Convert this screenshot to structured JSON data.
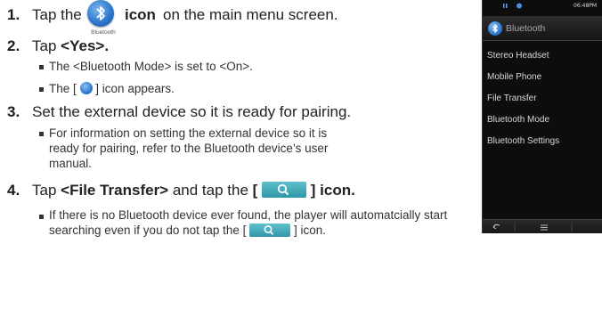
{
  "step1": {
    "number": "1.",
    "text_before": "Tap the",
    "icon_caption": "Bluetooth",
    "icon_bold": "icon",
    "text_after": "on the main menu screen."
  },
  "step2": {
    "number": "2.",
    "text": "Tap",
    "bold": "<Yes>.",
    "bullets": [
      "The <Bluetooth Mode> is set to <On>.",
      {
        "before": "The [",
        "after": "] icon appears."
      }
    ]
  },
  "step3": {
    "number": "3.",
    "text": "Set the external device so it is ready for pairing.",
    "bullet_lines": [
      "For information on setting the external device so it is",
      "ready for pairing, refer to the Bluetooth device’s user",
      "manual."
    ]
  },
  "step4": {
    "number": "4.",
    "text_before": "Tap",
    "bold1": "<File Transfer>",
    "text_mid": "and tap the",
    "bold_open": "[",
    "bold_close": "] icon.",
    "bullet_line1": "If there is no Bluetooth device ever found, the player will automatcially start",
    "bullet_line2_before": "searching even if you do not tap the [",
    "bullet_line2_after": "] icon."
  },
  "phone": {
    "time": "06:48PM",
    "header_title": "Bluetooth",
    "menu_items": [
      "Stereo Headset",
      "Mobile Phone",
      "File Transfer",
      "Bluetooth Mode",
      "Bluetooth Settings"
    ],
    "back_icon": "back-arrow-icon",
    "menu_icon": "menu-lines-icon"
  },
  "colors": {
    "bluetooth_blue": "#2f79cf",
    "search_teal": "#3aa7b6",
    "phone_bg": "#0d0d0d"
  }
}
